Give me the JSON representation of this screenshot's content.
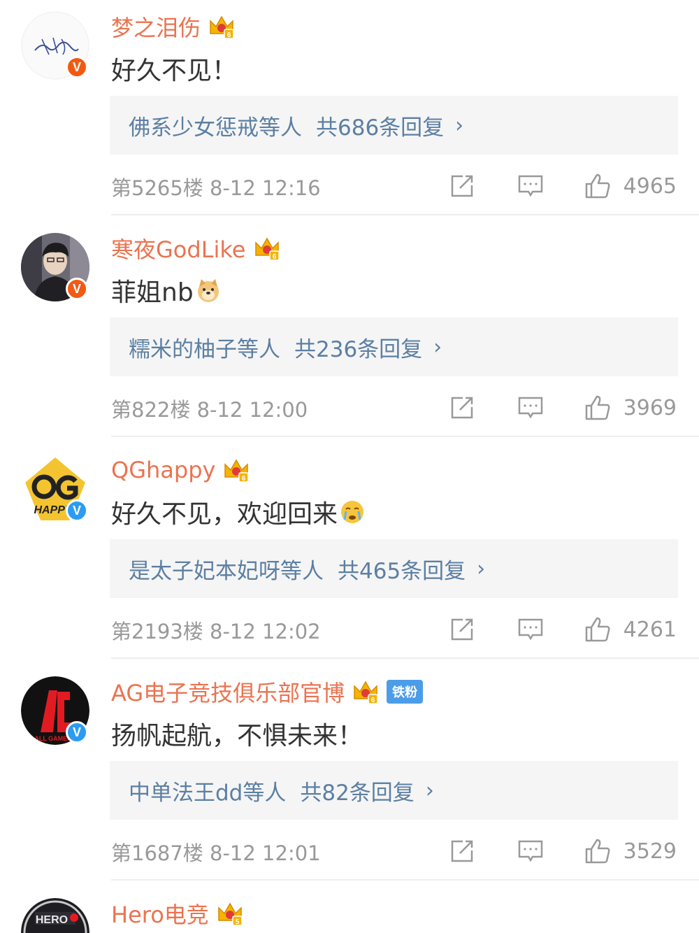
{
  "comments": [
    {
      "username": "梦之泪伤",
      "verify": "v-orange",
      "badge_letter": "V",
      "text": "好久不见！",
      "emoji": "",
      "reply_users": "佛系少女惩戒等人",
      "reply_count": "共686条回复",
      "floor_time": "第5265楼 8-12 12:16",
      "likes": "4965",
      "fan_tag": ""
    },
    {
      "username": "寒夜GodLike",
      "verify": "v-orange",
      "badge_letter": "V",
      "text": "菲姐nb",
      "emoji": "doge",
      "reply_users": "糯米的柚子等人",
      "reply_count": "共236条回复",
      "floor_time": "第822楼 8-12 12:00",
      "likes": "3969",
      "fan_tag": ""
    },
    {
      "username": "QGhappy",
      "verify": "v-blue",
      "badge_letter": "V",
      "text": "好久不见，欢迎回来",
      "emoji": "cry",
      "reply_users": "是太子妃本妃呀等人",
      "reply_count": "共465条回复",
      "floor_time": "第2193楼 8-12 12:02",
      "likes": "4261",
      "fan_tag": ""
    },
    {
      "username": "AG电子竞技俱乐部官博",
      "verify": "v-blue",
      "badge_letter": "V",
      "text": "扬帆起航，不惧未来！",
      "emoji": "",
      "reply_users": "中单法王dd等人",
      "reply_count": "共82条回复",
      "floor_time": "第1687楼 8-12 12:01",
      "likes": "3529",
      "fan_tag": "铁粉"
    },
    {
      "username": "Hero电竞",
      "verify": "",
      "badge_letter": "",
      "text": "",
      "emoji": "",
      "reply_users": "",
      "reply_count": "",
      "floor_time": "",
      "likes": "",
      "fan_tag": ""
    }
  ],
  "icons": {
    "crown": "crown-level-6-icon",
    "share": "share-icon",
    "comment": "comment-icon",
    "like": "like-icon",
    "chevron": "chevron-right-icon"
  },
  "colors": {
    "username": "#eb7350",
    "reply_link": "#5c7fa3",
    "meta": "#999999",
    "verify_orange": "#f25a13",
    "verify_blue": "#2b9cf2",
    "crown": "#f5b400"
  },
  "reply_chevron": "›"
}
